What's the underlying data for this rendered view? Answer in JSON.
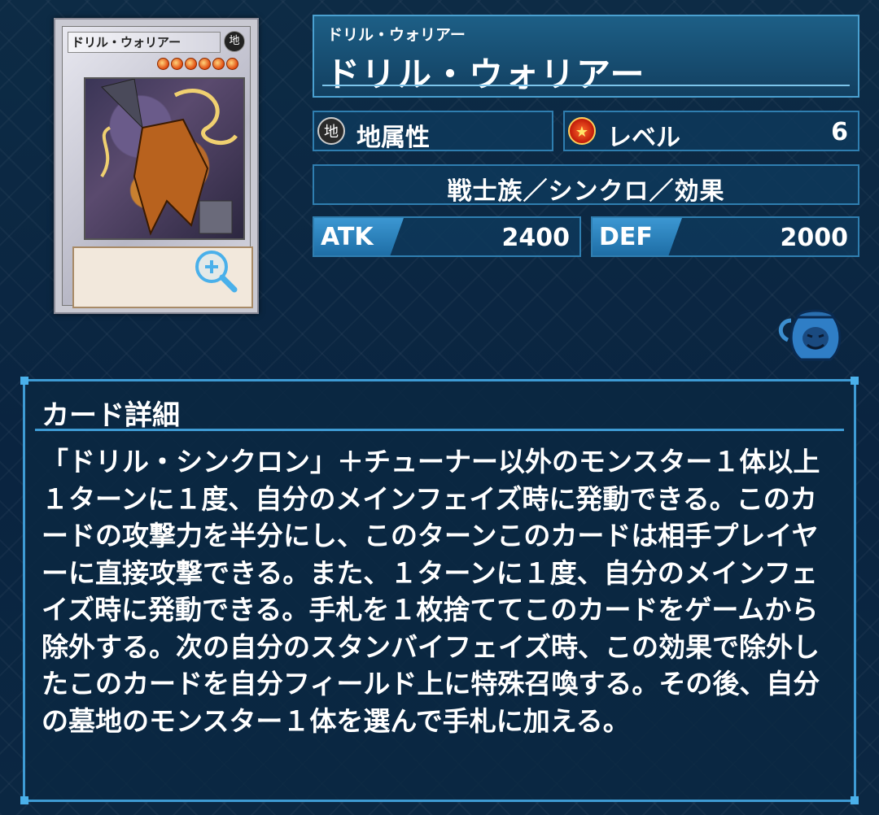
{
  "card": {
    "thumb_name": "ドリル・ウォリアー",
    "thumb_attribute_glyph": "地",
    "ruby": "ドリル・ウォリアー",
    "name": "ドリル・ウォリアー",
    "attribute": "地属性",
    "attribute_glyph": "地",
    "level_label": "レベル",
    "level_value": "6",
    "type_line": "戦士族／シンクロ／効果",
    "atk_label": "ATK",
    "atk_value": "2400",
    "def_label": "DEF",
    "def_value": "2000",
    "stars": 6
  },
  "detail": {
    "title": "カード詳細",
    "text": "「ドリル・シンクロン」＋チューナー以外のモンスター１体以上\n１ターンに１度、自分のメインフェイズ時に発動できる。このカードの攻撃力を半分にし、このターンこのカードは相手プレイヤーに直接攻撃できる。また、１ターンに１度、自分のメインフェイズ時に発動できる。手札を１枚捨ててこのカードをゲームから除外する。次の自分のスタンバイフェイズ時、この効果で除外したこのカードを自分フィールド上に特殊召喚する。その後、自分の墓地のモンスター１体を選んで手札に加える。"
  },
  "icons": {
    "zoom": "zoom-in-icon",
    "attribute": "earth-attribute-icon",
    "level": "level-star-icon",
    "pot": "pot-of-greed-icon"
  },
  "colors": {
    "accent": "#3e9bd4",
    "panel": "#0e385a"
  }
}
